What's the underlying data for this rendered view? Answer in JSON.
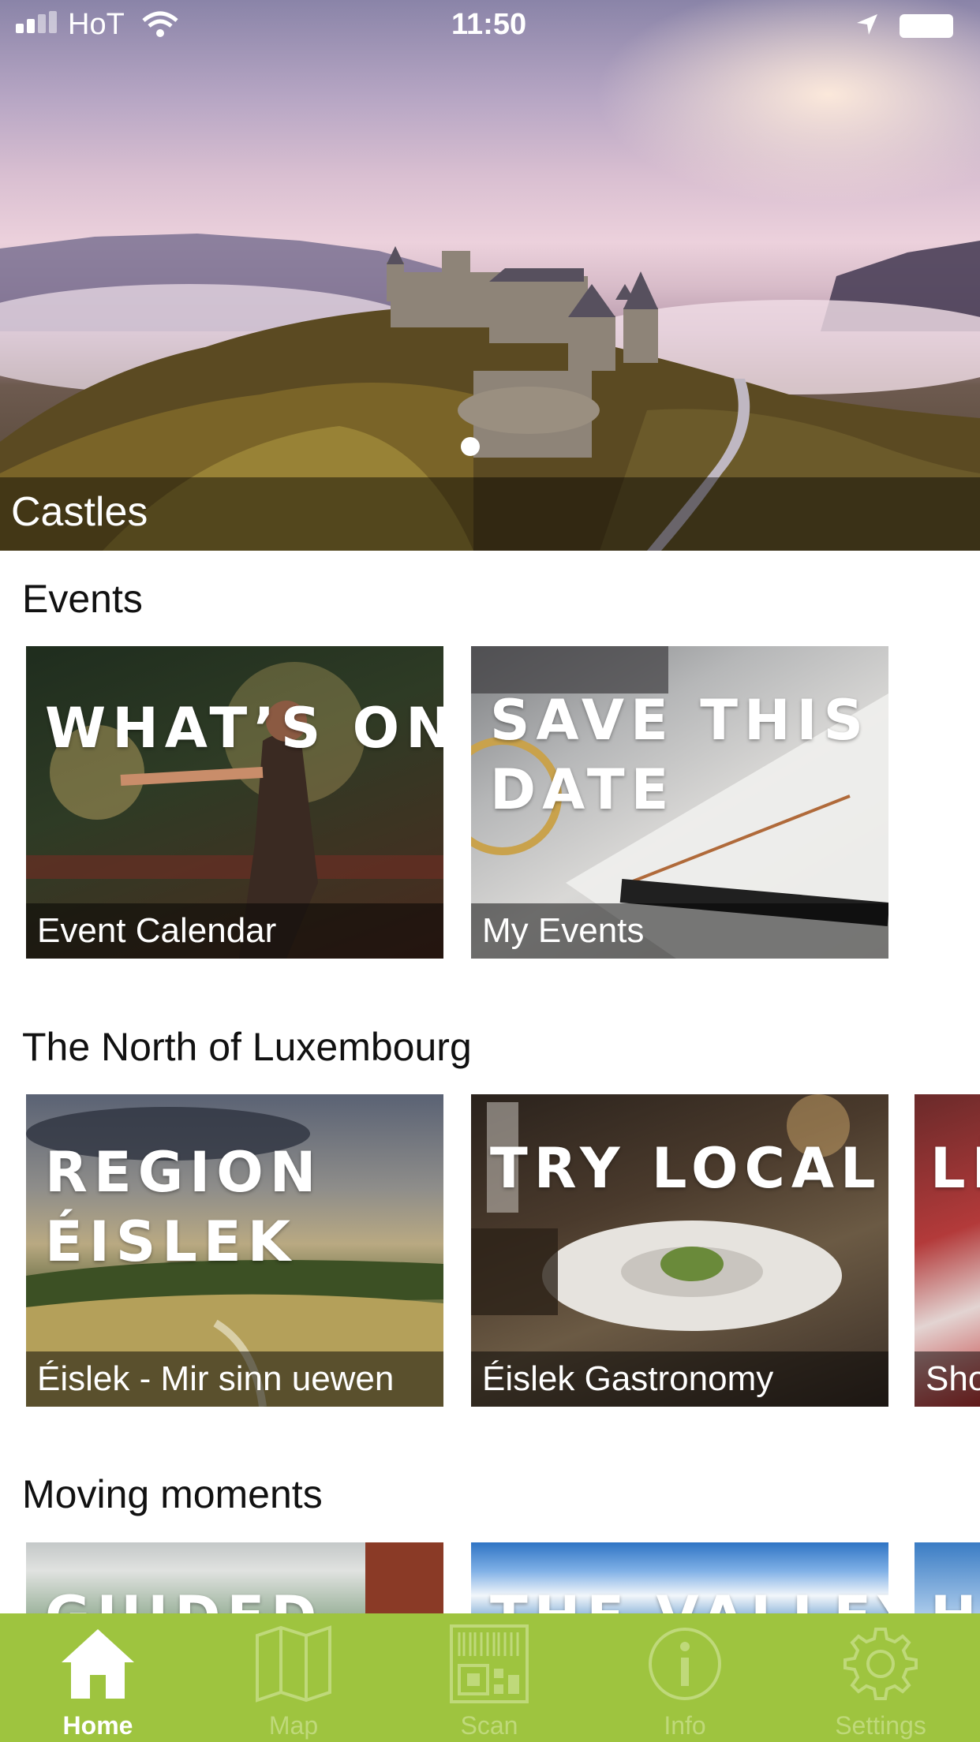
{
  "status_bar": {
    "carrier": "HoT",
    "time": "11:50"
  },
  "hero": {
    "caption": "Castles"
  },
  "sections": [
    {
      "title": "Events",
      "cards": [
        {
          "overlay_line1": "WHAT’S ON",
          "overlay_line2": "",
          "caption": "Event Calendar"
        },
        {
          "overlay_line1": "SAVE THIS",
          "overlay_line2": "DATE",
          "caption": "My Events"
        }
      ]
    },
    {
      "title": "The North of Luxembourg",
      "cards": [
        {
          "overlay_line1": "REGION",
          "overlay_line2": "ÉISLEK",
          "caption": "Éislek - Mir sinn uewen"
        },
        {
          "overlay_line1": "TRY LOCAL",
          "overlay_line2": "",
          "caption": "Éislek Gastronomy"
        },
        {
          "overlay_line1": "LË",
          "overlay_line2": "",
          "caption": "Sho"
        }
      ]
    },
    {
      "title": "Moving moments",
      "cards": [
        {
          "overlay_line1": "GUIDED"
        },
        {
          "overlay_line1": "THE VALLEYS"
        },
        {
          "overlay_line1": "H"
        }
      ]
    }
  ],
  "tab_bar": {
    "accent": "#9ec43f",
    "items": [
      {
        "label": "Home",
        "icon": "home-icon",
        "active": true
      },
      {
        "label": "Map",
        "icon": "map-icon",
        "active": false
      },
      {
        "label": "Scan",
        "icon": "qr-code-icon",
        "active": false
      },
      {
        "label": "Info",
        "icon": "info-icon",
        "active": false
      },
      {
        "label": "Settings",
        "icon": "gear-icon",
        "active": false
      }
    ]
  }
}
